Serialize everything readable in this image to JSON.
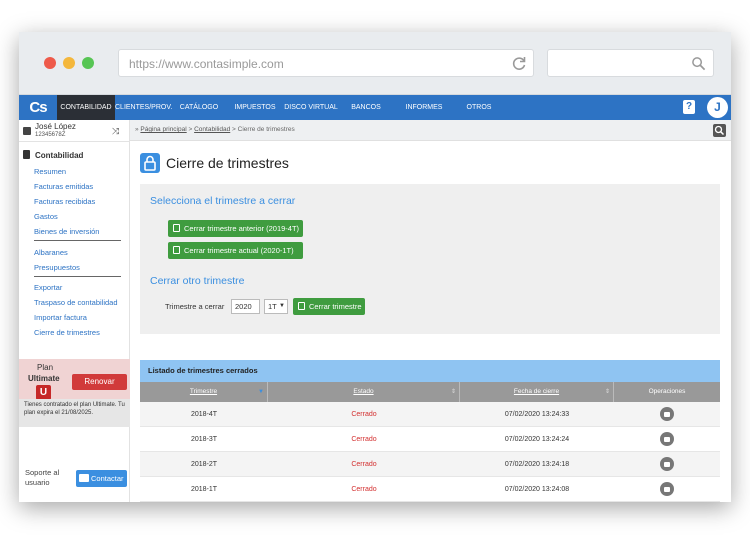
{
  "browser": {
    "url": "https://www.contasimple.com",
    "dot_colors": [
      "#ee5a4a",
      "#f4b73c",
      "#57c554"
    ]
  },
  "nav": {
    "logo": "Cs",
    "items": [
      "CONTABILIDAD",
      "CLIENTES/PROV.",
      "CATÁLOGO",
      "IMPUESTOS",
      "DISCO VIRTUAL",
      "BANCOS",
      "INFORMES",
      "OTROS"
    ],
    "active": "CONTABILIDAD",
    "help": "?",
    "avatar": "J",
    "accent": "#2d73c4"
  },
  "user": {
    "name": "José López",
    "id": "12345678Z"
  },
  "sidebar": {
    "section": "Contabilidad",
    "group1": [
      "Resumen",
      "Facturas emitidas",
      "Facturas recibidas",
      "Gastos",
      "Bienes de inversión"
    ],
    "group2": [
      "Albaranes",
      "Presupuestos"
    ],
    "group3": [
      "Exportar",
      "Traspaso de contabilidad",
      "Importar factura",
      "Cierre de trimestres"
    ]
  },
  "plan": {
    "label": "Plan",
    "name": "Ultimate",
    "badge": "U",
    "renew": "Renovar",
    "info": "Tienes contratado el plan Ultimate. Tu plan expira el 21/08/2025."
  },
  "support": {
    "label": "Soporte al usuario",
    "contact": "Contactar"
  },
  "breadcrumb": {
    "home": "Página principal",
    "section": "Contabilidad",
    "current": "Cierre de trimestres"
  },
  "page": {
    "title": "Cierre de trimestres",
    "select_heading": "Selecciona el trimestre a cerrar",
    "btn_previous": "Cerrar trimestre anterior (2019-4T)",
    "btn_current": "Cerrar trimestre actual (2020-1T)",
    "other_heading": "Cerrar otro trimestre",
    "quarter_label": "Trimestre a cerrar",
    "year_value": "2020",
    "quarter_value": "1T",
    "close_btn": "Cerrar trimestre"
  },
  "table": {
    "title": "Listado de trimestres cerrados",
    "columns": [
      "Trimestre",
      "Estado",
      "Fecha de cierre",
      "Operaciones"
    ],
    "rows": [
      {
        "trimestre": "2018-4T",
        "estado": "Cerrado",
        "fecha": "07/02/2020 13:24:33"
      },
      {
        "trimestre": "2018-3T",
        "estado": "Cerrado",
        "fecha": "07/02/2020 13:24:24"
      },
      {
        "trimestre": "2018-2T",
        "estado": "Cerrado",
        "fecha": "07/02/2020 13:24:18"
      },
      {
        "trimestre": "2018-1T",
        "estado": "Cerrado",
        "fecha": "07/02/2020 13:24:08"
      }
    ]
  }
}
